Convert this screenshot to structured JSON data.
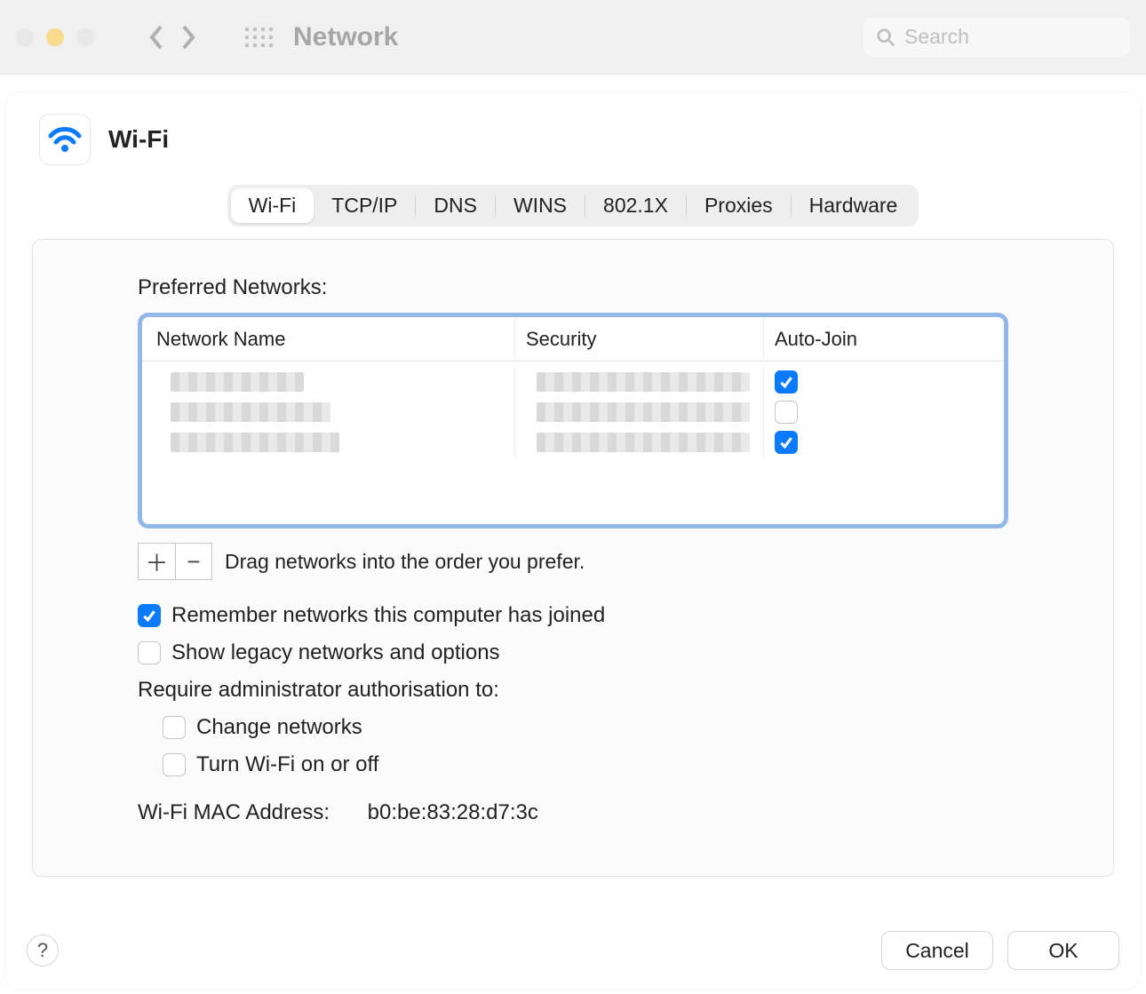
{
  "toolbar": {
    "title": "Network",
    "search_placeholder": "Search"
  },
  "sheet": {
    "title": "Wi-Fi",
    "tabs": [
      {
        "label": "Wi-Fi",
        "selected": true
      },
      {
        "label": "TCP/IP",
        "selected": false
      },
      {
        "label": "DNS",
        "selected": false
      },
      {
        "label": "WINS",
        "selected": false
      },
      {
        "label": "802.1X",
        "selected": false
      },
      {
        "label": "Proxies",
        "selected": false
      },
      {
        "label": "Hardware",
        "selected": false
      }
    ],
    "preferred_label": "Preferred Networks:",
    "columns": {
      "name": "Network Name",
      "security": "Security",
      "autojoin": "Auto-Join"
    },
    "networks": [
      {
        "name_redacted": true,
        "security_redacted": true,
        "auto_join": true
      },
      {
        "name_redacted": true,
        "security_redacted": true,
        "auto_join": false
      },
      {
        "name_redacted": true,
        "security_redacted": true,
        "auto_join": true
      }
    ],
    "drag_hint": "Drag networks into the order you prefer.",
    "options": {
      "remember": {
        "label": "Remember networks this computer has joined",
        "checked": true
      },
      "show_legacy": {
        "label": "Show legacy networks and options",
        "checked": false
      },
      "require_admin_label": "Require administrator authorisation to:",
      "change_networks": {
        "label": "Change networks",
        "checked": false
      },
      "toggle_wifi": {
        "label": "Turn Wi-Fi on or off",
        "checked": false
      }
    },
    "mac": {
      "label": "Wi-Fi MAC Address:",
      "value": "b0:be:83:28:d7:3c"
    },
    "buttons": {
      "cancel": "Cancel",
      "ok": "OK"
    }
  }
}
